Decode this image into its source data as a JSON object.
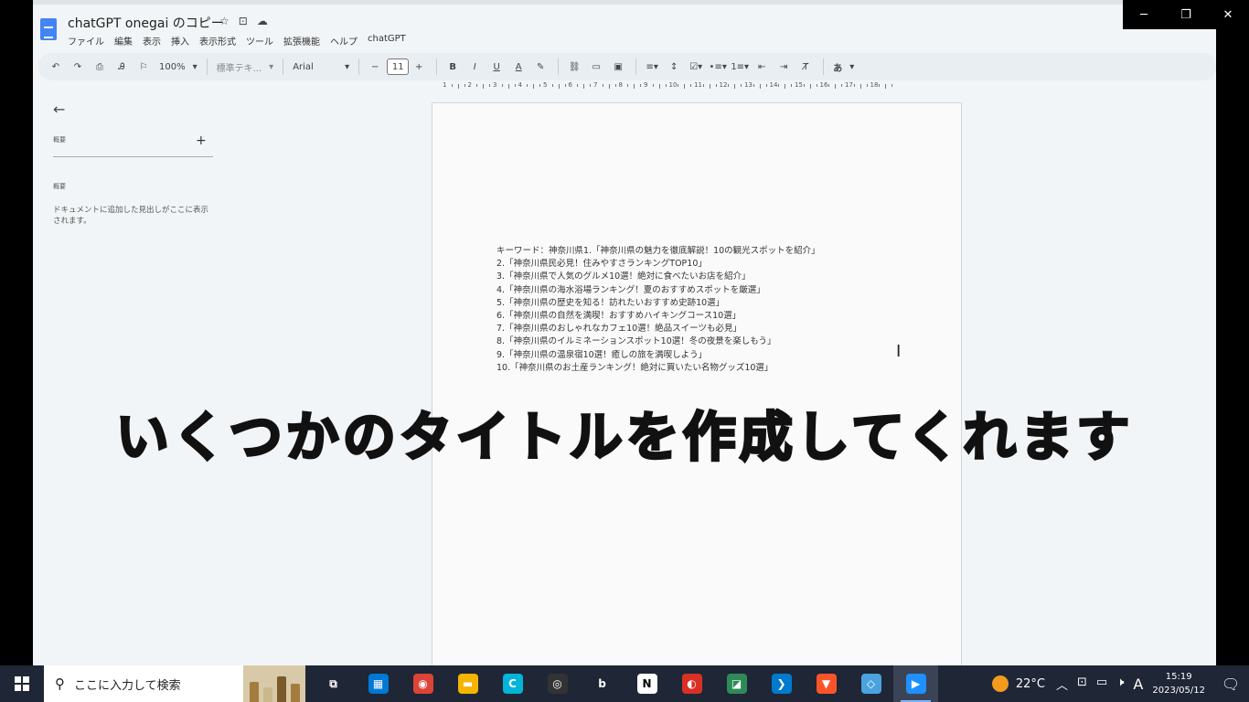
{
  "window": {
    "minimize_glyph": "─",
    "restore_glyph": "❐",
    "close_glyph": "✕"
  },
  "docs": {
    "title": "chatGPT onegai のコピー",
    "title_icons": [
      "☆",
      "⊡",
      "☁"
    ],
    "menus": [
      "ファイル",
      "編集",
      "表示",
      "挿入",
      "表示形式",
      "ツール",
      "拡張機能",
      "ヘルプ",
      "chatGPT"
    ],
    "toolbar": {
      "zoom": "100%",
      "style": "標準テキ...",
      "font": "Arial",
      "font_size": "11",
      "input_tool": "あ"
    },
    "ruler_numbers": [
      "1",
      "2",
      "3",
      "4",
      "5",
      "6",
      "7",
      "8",
      "9",
      "10",
      "11",
      "12",
      "13",
      "14",
      "15",
      "16",
      "17",
      "18"
    ]
  },
  "sidebar": {
    "back_glyph": "←",
    "outline_label": "概要",
    "add_glyph": "+",
    "summary_label": "概要",
    "hint": "ドキュメントに追加した見出しがここに表示されます。"
  },
  "document": {
    "lines": [
      "キーワード：神奈川県1.「神奈川県の魅力を徹底解説！10の観光スポットを紹介」",
      "2.「神奈川県民必見！住みやすさランキングTOP10」",
      "3.「神奈川県で人気のグルメ10選！絶対に食べたいお店を紹介」",
      "4.「神奈川県の海水浴場ランキング！夏のおすすめスポットを厳選」",
      "5.「神奈川県の歴史を知る！訪れたいおすすめ史跡10選」",
      "6.「神奈川県の自然を満喫！おすすめハイキングコース10選」",
      "7.「神奈川県のおしゃれなカフェ10選！絶品スイーツも必見」",
      "8.「神奈川県のイルミネーションスポット10選！冬の夜景を楽しもう」",
      "9.「神奈川県の温泉宿10選！癒しの旅を満喫しよう」",
      "10.「神奈川県のお土産ランキング！絶対に買いたい名物グッズ10選」"
    ]
  },
  "overlay_caption": "いくつかのタイトルを作成してくれます",
  "taskbar": {
    "search_placeholder": "ここに入力して検索",
    "apps": [
      {
        "name": "task-view",
        "glyph": "⧉",
        "color": "#1f2636"
      },
      {
        "name": "microsoft-store",
        "glyph": "▦",
        "color": "#0078d4"
      },
      {
        "name": "chrome",
        "glyph": "◉",
        "color": "#db4437"
      },
      {
        "name": "file-explorer",
        "glyph": "▬",
        "color": "#f4b400"
      },
      {
        "name": "canva",
        "glyph": "C",
        "color": "#00b5d8"
      },
      {
        "name": "obs",
        "glyph": "◎",
        "color": "#333"
      },
      {
        "name": "bing",
        "glyph": "b",
        "color": "#1f2636"
      },
      {
        "name": "notion",
        "glyph": "N",
        "color": "#fff"
      },
      {
        "name": "app-red",
        "glyph": "◐",
        "color": "#d93025"
      },
      {
        "name": "app-green",
        "glyph": "◪",
        "color": "#2e8b57"
      },
      {
        "name": "vscode",
        "glyph": "❯",
        "color": "#007acc"
      },
      {
        "name": "brave",
        "glyph": "▼",
        "color": "#fb542b"
      },
      {
        "name": "app-notes",
        "glyph": "◇",
        "color": "#4aa3df"
      },
      {
        "name": "video-editor",
        "glyph": "▶",
        "color": "#1e90ff"
      }
    ],
    "temperature": "22°C",
    "ime": "A",
    "time": "15:19",
    "date": "2023/05/12"
  }
}
